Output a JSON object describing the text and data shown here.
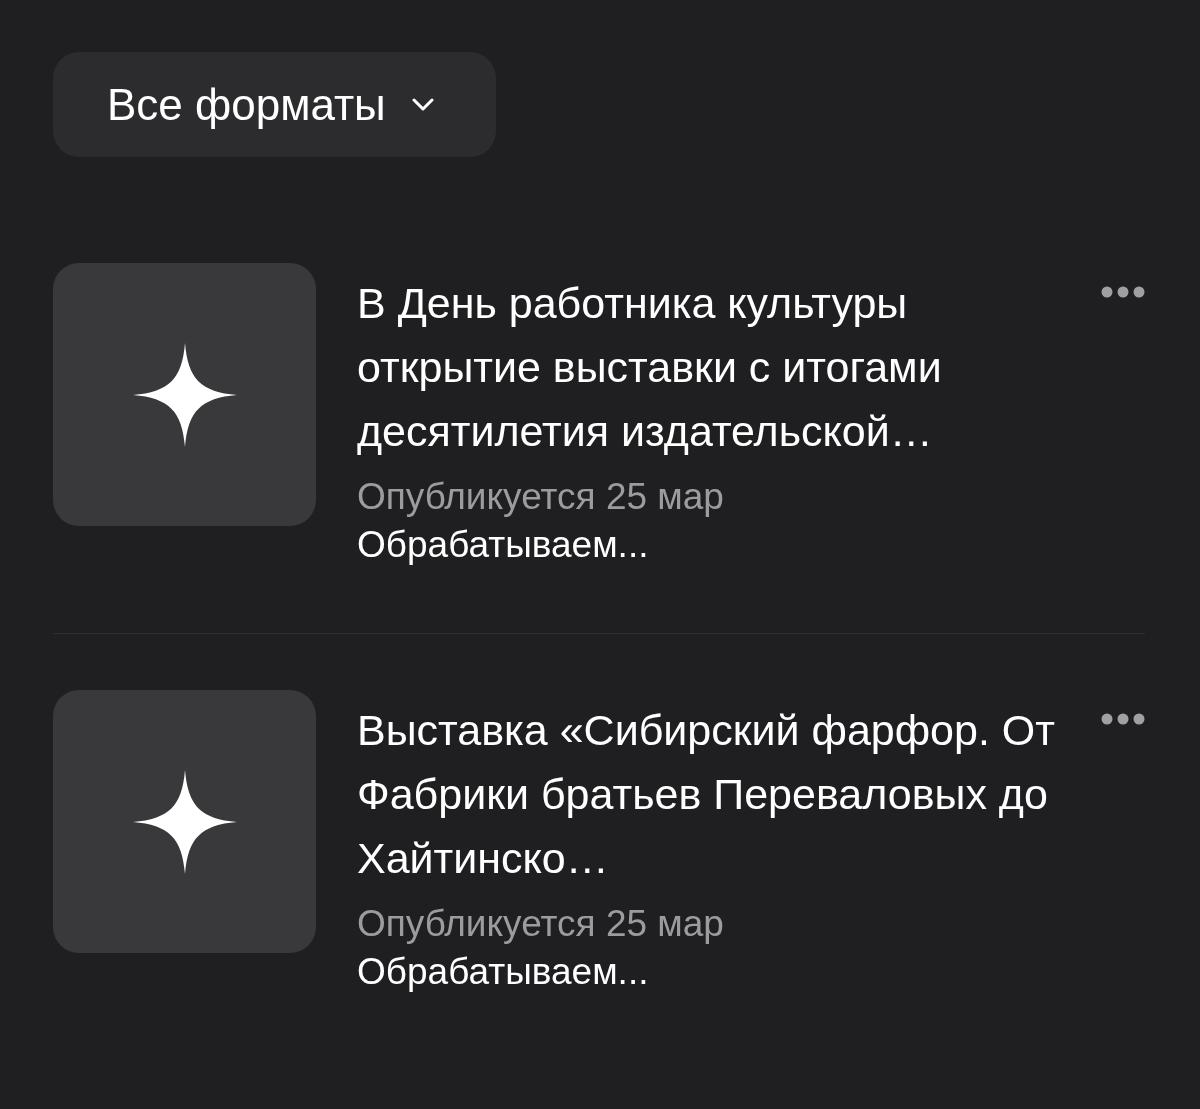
{
  "filter": {
    "label": "Все форматы"
  },
  "items": [
    {
      "title": "В День работника культуры открытие выставки с итогами десятилетия издательской…",
      "publish": "Опубликуется 25 мар",
      "status": "Обрабатываем..."
    },
    {
      "title": "Выставка «Сибирский фарфор. От Фабрики братьев Переваловых до Хайтинско…",
      "publish": "Опубликуется 25 мар",
      "status": "Обрабатываем..."
    }
  ]
}
